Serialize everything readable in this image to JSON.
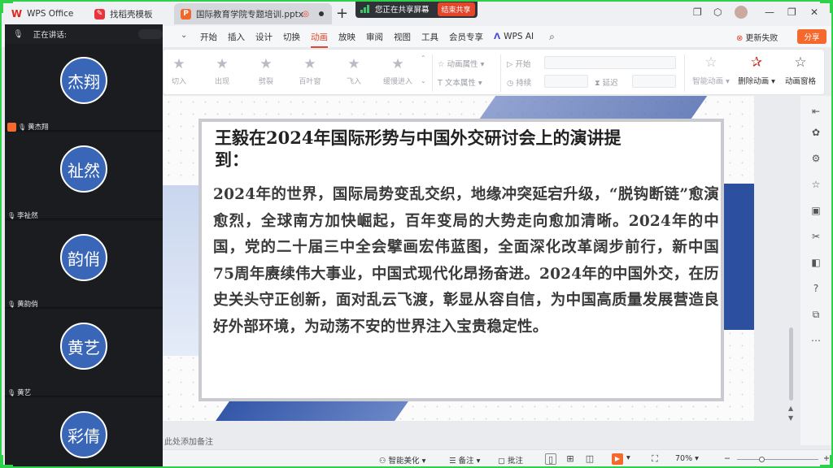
{
  "tabs": [
    {
      "label": "WPS Office",
      "icon": "wps-logo-icon"
    },
    {
      "label": "找稻壳模板",
      "icon": "docer-icon"
    },
    {
      "label": "国际教育学院专题培训.pptx",
      "icon": "ppt-file-icon"
    }
  ],
  "share_banner": {
    "text": "您正在共享屏幕",
    "stop_label": "结束共享",
    "accent": "#3ec46d"
  },
  "menu": {
    "items": [
      "开始",
      "插入",
      "设计",
      "切换",
      "动画",
      "放映",
      "审阅",
      "视图",
      "工具",
      "会员专享"
    ],
    "active": "动画",
    "ai_label": "WPS AI",
    "sync_status": "更新失败",
    "share_label": "分享"
  },
  "ribbon": {
    "animations": [
      "切入",
      "出现",
      "劈裂",
      "百叶窗",
      "飞入",
      "缓慢进入"
    ],
    "anim_props": "动画属性",
    "text_props": "文本属性",
    "start_label": "开始",
    "duration_label": "持续",
    "delay_label": "延迟",
    "smart_anim": "智能动画",
    "delete_anim": "删除动画",
    "anim_pane": "动画窗格"
  },
  "slide": {
    "title": "王毅在2024年国际形势与中国外交研讨会上的演讲提到：",
    "body": "2024年的世界，国际局势变乱交织，地缘冲突延宕升级，“脱钩断链”愈演愈烈，全球南方加快崛起，百年变局的大势走向愈加清晰。2024年的中国，党的二十届三中全会擘画宏伟蓝图，全面深化改革阔步前行，新中国75周年赓续伟大事业，中国式现代化昂扬奋进。2024年的中国外交，在历史关头守正创新，面对乱云飞渡，彰显从容自信，为中国高质量发展营造良好外部环境，为动荡不安的世界注入宝贵稳定性。"
  },
  "notes_hint": "此处添加备注",
  "status": {
    "beautify": "智能美化",
    "notes": "备注",
    "comment": "批注",
    "zoom": "70%",
    "zoom_fraction": 0.3
  },
  "meeting": {
    "speaking_label": "正在讲话:",
    "participants": [
      {
        "avatar": "杰翔",
        "name": "黄杰翔",
        "host": true
      },
      {
        "avatar": "祉然",
        "name": "李祉然",
        "host": false
      },
      {
        "avatar": "韵俏",
        "name": "黄韵俏",
        "host": false
      },
      {
        "avatar": "黄艺",
        "name": "黄艺",
        "host": false
      },
      {
        "avatar": "彩倩",
        "name": "",
        "host": false
      }
    ],
    "avatar_color": "#3a66b8"
  }
}
